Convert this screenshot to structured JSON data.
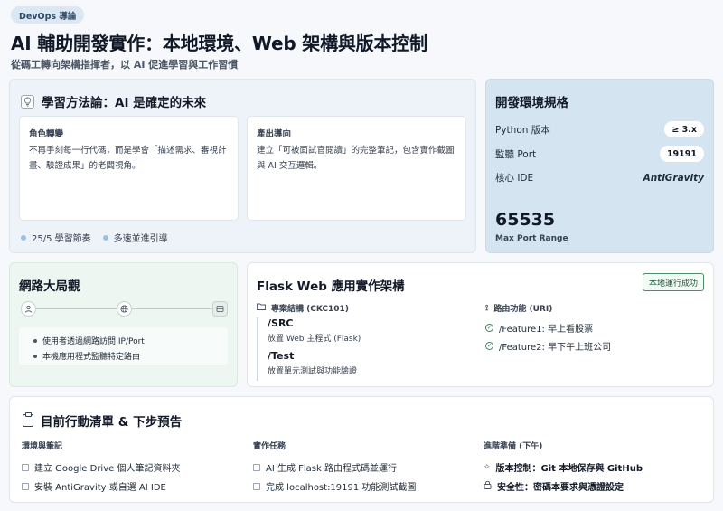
{
  "header": {
    "badge": "DevOps 導論",
    "title": "AI 輔助開發實作：本地環境、Web 架構與版本控制",
    "subtitle": "從碼工轉向架構指揮者，以 AI 促進學習與工作習慣"
  },
  "method": {
    "title": "學習方法論：AI 是確定的未來",
    "icon": "lightbulb-icon",
    "cards": [
      {
        "label": "角色轉變",
        "text": "不再手刻每一行代碼，而是學會「描述需求、審視計畫、驗證成果」的老闆視角。"
      },
      {
        "label": "產出導向",
        "text": "建立「可被面試官閱讀」的完整筆記，包含實作截圖與 AI 交互邏輯。"
      }
    ],
    "tags": [
      "25/5 學習節奏",
      "多速並進引導"
    ]
  },
  "spec": {
    "title": "開發環境規格",
    "rows": [
      {
        "key": "Python 版本",
        "value": "≥ 3.x"
      },
      {
        "key": "監聽 Port",
        "value": "19191"
      },
      {
        "key": "核心 IDE",
        "value": "AntiGravity"
      }
    ],
    "big_number": "65535",
    "big_caption": "Max Port Range"
  },
  "network": {
    "title": "網路大局觀",
    "nodes": [
      "user-icon",
      "globe-icon",
      "server-icon"
    ],
    "items": [
      "使用者透過網路訪問 IP/Port",
      "本機應用程式監聽特定路由"
    ]
  },
  "flask": {
    "title": "Flask Web 應用實作架構",
    "status": "本地運行成功",
    "structure_header": "專案結構 (CKC101)",
    "dirs": [
      {
        "name": "/SRC",
        "desc": "放置 Web 主程式 (Flask)"
      },
      {
        "name": "/Test",
        "desc": "放置單元測試與功能驗證"
      }
    ],
    "routes_header": "路由功能 (URI)",
    "routes": [
      "/Feature1: 早上看股票",
      "/Feature2: 早下午上班公司"
    ]
  },
  "actions": {
    "title": "目前行動清單 & 下步預告",
    "columns": [
      {
        "header": "環境與筆記",
        "items": [
          "建立 Google Drive 個人筆記資料夾",
          "安裝 AntiGravity 或自選 AI IDE"
        ]
      },
      {
        "header": "實作任務",
        "items": [
          "AI 生成 Flask 路由程式碼並運行",
          "完成 localhost:19191 功能測試截圖"
        ]
      },
      {
        "header": "進階準備 (下午)",
        "items": [
          "版本控制：Git 本地保存與 GitHub",
          "安全性：密碼本要求與憑證設定"
        ]
      }
    ]
  },
  "colors": {
    "page_bg": "#f6f8fb",
    "spec_bg": "#d4e5f1",
    "net_bg": "#edf6f1",
    "success": "#3f7d5b"
  }
}
